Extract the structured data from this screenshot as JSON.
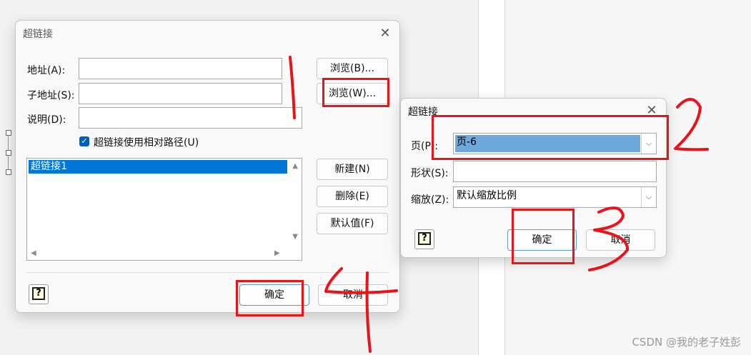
{
  "main_dialog": {
    "title": "超链接",
    "address_label": "地址(A):",
    "address_value": "",
    "subaddress_label": "子地址(S):",
    "subaddress_value": "",
    "description_label": "说明(D):",
    "description_value": "",
    "browse_b_label": "浏览(B)...",
    "browse_w_label": "浏览(W)...",
    "relative_path_label": "超链接使用相对路径(U)",
    "relative_path_checked": true,
    "list_items": [
      "超链接1"
    ],
    "new_label": "新建(N)",
    "delete_label": "删除(E)",
    "default_label": "默认值(F)",
    "ok_label": "确定",
    "cancel_label": "取消"
  },
  "sub_dialog": {
    "title": "超链接",
    "page_label": "页(P):",
    "page_value": "页-6",
    "shape_label": "形状(S):",
    "shape_value": "",
    "zoom_label": "缩放(Z):",
    "zoom_value": "默认缩放比例",
    "ok_label": "确定",
    "cancel_label": "取消"
  },
  "watermark": "CSDN @我的老子姓彭",
  "annotation_color": "#e8141c"
}
